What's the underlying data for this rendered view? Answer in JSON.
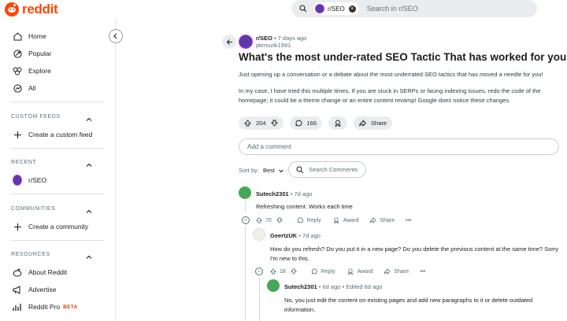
{
  "header": {
    "logo_text": "reddit",
    "search_chip": "r/SEO",
    "search_placeholder": "Search in r/SEO",
    "brand_color": "#ff4500"
  },
  "sidebar": {
    "primary": [
      {
        "label": "Home",
        "icon": "home-icon"
      },
      {
        "label": "Popular",
        "icon": "popular-icon"
      },
      {
        "label": "Explore",
        "icon": "explore-icon"
      },
      {
        "label": "All",
        "icon": "all-icon"
      }
    ],
    "custom_feeds": {
      "title": "CUSTOM FEEDS",
      "items": [
        {
          "label": "Create a custom feed"
        }
      ]
    },
    "recent": {
      "title": "RECENT",
      "items": [
        {
          "label": "r/SEO"
        }
      ]
    },
    "communities": {
      "title": "COMMUNITIES",
      "items": [
        {
          "label": "Create a community"
        }
      ]
    },
    "resources": {
      "title": "RESOURCES",
      "items": [
        {
          "label": "About Reddit"
        },
        {
          "label": "Advertise"
        },
        {
          "label": "Reddit Pro",
          "badge": "BETA"
        }
      ]
    }
  },
  "post": {
    "subreddit": "r/SEO",
    "age": "• 7 days ago",
    "author": "pkmuzik1991",
    "title": "What's the most under-rated SEO Tactic That has worked for you?",
    "body": [
      "Just opening up a conversation or a debate about the most underrated SEO tactics that has moved a needle for you!",
      "In my case, I have tried this multiple times. If you are stuck in SERPs or facing indexing issues, redo the code of the homepage; it could be a theme change or an entire content revamp! Google does notice these changes."
    ],
    "votes": "204",
    "comments": "166",
    "share_label": "Share"
  },
  "comment_box": {
    "placeholder": "Add a comment"
  },
  "sort": {
    "label": "Sort by:",
    "value": "Best",
    "search_label": "Search Comments"
  },
  "comments": [
    {
      "author": "Sutech2301",
      "meta": "• 7d ago",
      "text": "Refreshing content. Works each time",
      "votes": "70",
      "reply": "Reply",
      "award": "Award",
      "share": "Share",
      "more": "•••"
    },
    {
      "author": "GeertzUK",
      "meta": "• 7d ago",
      "text": "How do you refresh? Do you put it in a new page? Do you delete the previous content at the same time? Sorry I'm new to this.",
      "votes": "18",
      "reply": "Reply",
      "award": "Award",
      "share": "Share",
      "more": "•••"
    },
    {
      "author": "Sutech2301",
      "meta": "• 6d ago • Edited 6d ago",
      "text": "No, you just edit the content on existing pages and add new paragraphs to it or delete outdated information."
    }
  ]
}
